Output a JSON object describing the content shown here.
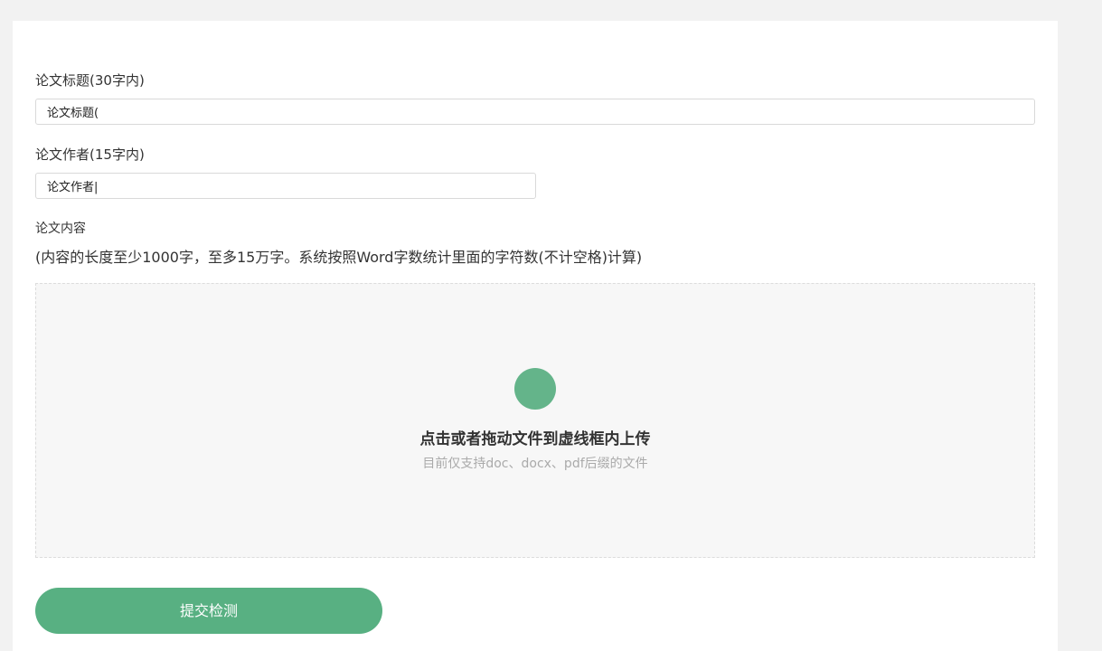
{
  "form": {
    "title_label": "论文标题(30字内)",
    "title_value": "论文标题(",
    "author_label": "论文作者(15字内)",
    "author_value": "论文作者|",
    "content_label": "论文内容",
    "content_hint": "(内容的长度至少1000字，至多15万字。系统按照Word字数统计里面的字符数(不计空格)计算)"
  },
  "upload": {
    "icon": "upload-icon",
    "accent_color": "#64b48a",
    "title": "点击或者拖动文件到虚线框内上传",
    "subtitle": "目前仅支持doc、docx、pdf后缀的文件"
  },
  "submit": {
    "label": "提交检测",
    "color": "#58b082"
  }
}
